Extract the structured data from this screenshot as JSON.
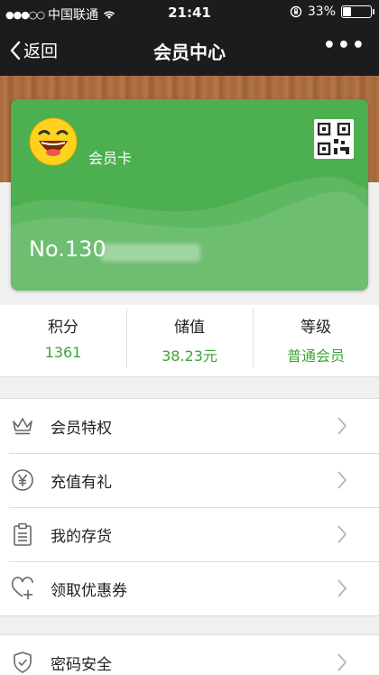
{
  "status_bar": {
    "carrier": "中国联通",
    "time": "21:41",
    "battery_text": "33%",
    "battery_level": 0.33
  },
  "nav": {
    "back_label": "返回",
    "title": "会员中心",
    "more_icon": "more-icon"
  },
  "card": {
    "label": "会员卡",
    "number_prefix": "No.130",
    "background_color": "#4caf50"
  },
  "stats": [
    {
      "label": "积分",
      "value": "1361"
    },
    {
      "label": "储值",
      "value": "38.23元"
    },
    {
      "label": "等级",
      "value": "普通会员"
    }
  ],
  "menu": [
    {
      "label": "会员特权",
      "icon": "crown-icon"
    },
    {
      "label": "充值有礼",
      "icon": "yen-icon"
    },
    {
      "label": "我的存货",
      "icon": "clipboard-icon"
    },
    {
      "label": "领取优惠券",
      "icon": "heart-plus-icon"
    }
  ],
  "menu2": [
    {
      "label": "密码安全",
      "icon": "shield-icon"
    }
  ],
  "colors": {
    "accent": "#3aa435",
    "nav_bg": "#1c1c1e"
  }
}
